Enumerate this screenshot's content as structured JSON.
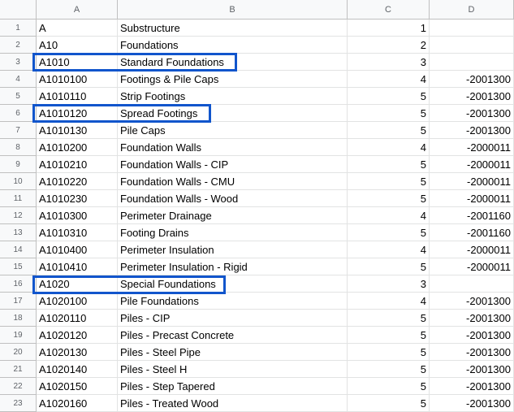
{
  "columns": [
    "A",
    "B",
    "C",
    "D"
  ],
  "rows": [
    {
      "n": "1",
      "a": "A",
      "b": "Substructure",
      "c": "1",
      "d": ""
    },
    {
      "n": "2",
      "a": "A10",
      "b": "Foundations",
      "c": "2",
      "d": ""
    },
    {
      "n": "3",
      "a": "A1010",
      "b": "Standard Foundations",
      "c": "3",
      "d": ""
    },
    {
      "n": "4",
      "a": "A1010100",
      "b": "Footings & Pile Caps",
      "c": "4",
      "d": "-2001300"
    },
    {
      "n": "5",
      "a": "A1010110",
      "b": "Strip Footings",
      "c": "5",
      "d": "-2001300"
    },
    {
      "n": "6",
      "a": "A1010120",
      "b": "Spread Footings",
      "c": "5",
      "d": "-2001300"
    },
    {
      "n": "7",
      "a": "A1010130",
      "b": "Pile Caps",
      "c": "5",
      "d": "-2001300"
    },
    {
      "n": "8",
      "a": "A1010200",
      "b": "Foundation Walls",
      "c": "4",
      "d": "-2000011"
    },
    {
      "n": "9",
      "a": "A1010210",
      "b": "Foundation Walls - CIP",
      "c": "5",
      "d": "-2000011"
    },
    {
      "n": "10",
      "a": "A1010220",
      "b": "Foundation Walls - CMU",
      "c": "5",
      "d": "-2000011"
    },
    {
      "n": "11",
      "a": "A1010230",
      "b": "Foundation Walls - Wood",
      "c": "5",
      "d": "-2000011"
    },
    {
      "n": "12",
      "a": "A1010300",
      "b": "Perimeter Drainage",
      "c": "4",
      "d": "-2001160"
    },
    {
      "n": "13",
      "a": "A1010310",
      "b": "Footing Drains",
      "c": "5",
      "d": "-2001160"
    },
    {
      "n": "14",
      "a": "A1010400",
      "b": "Perimeter Insulation",
      "c": "4",
      "d": "-2000011"
    },
    {
      "n": "15",
      "a": "A1010410",
      "b": "Perimeter Insulation - Rigid",
      "c": "5",
      "d": "-2000011"
    },
    {
      "n": "16",
      "a": "A1020",
      "b": "Special Foundations",
      "c": "3",
      "d": ""
    },
    {
      "n": "17",
      "a": "A1020100",
      "b": "Pile Foundations",
      "c": "4",
      "d": "-2001300"
    },
    {
      "n": "18",
      "a": "A1020110",
      "b": "Piles - CIP",
      "c": "5",
      "d": "-2001300"
    },
    {
      "n": "19",
      "a": "A1020120",
      "b": "Piles - Precast Concrete",
      "c": "5",
      "d": "-2001300"
    },
    {
      "n": "20",
      "a": "A1020130",
      "b": "Piles - Steel Pipe",
      "c": "5",
      "d": "-2001300"
    },
    {
      "n": "21",
      "a": "A1020140",
      "b": "Piles - Steel H",
      "c": "5",
      "d": "-2001300"
    },
    {
      "n": "22",
      "a": "A1020150",
      "b": "Piles - Step Tapered",
      "c": "5",
      "d": "-2001300"
    },
    {
      "n": "23",
      "a": "A1020160",
      "b": "Piles - Treated Wood",
      "c": "5",
      "d": "-2001300"
    }
  ],
  "highlight_color": "#1155cc"
}
